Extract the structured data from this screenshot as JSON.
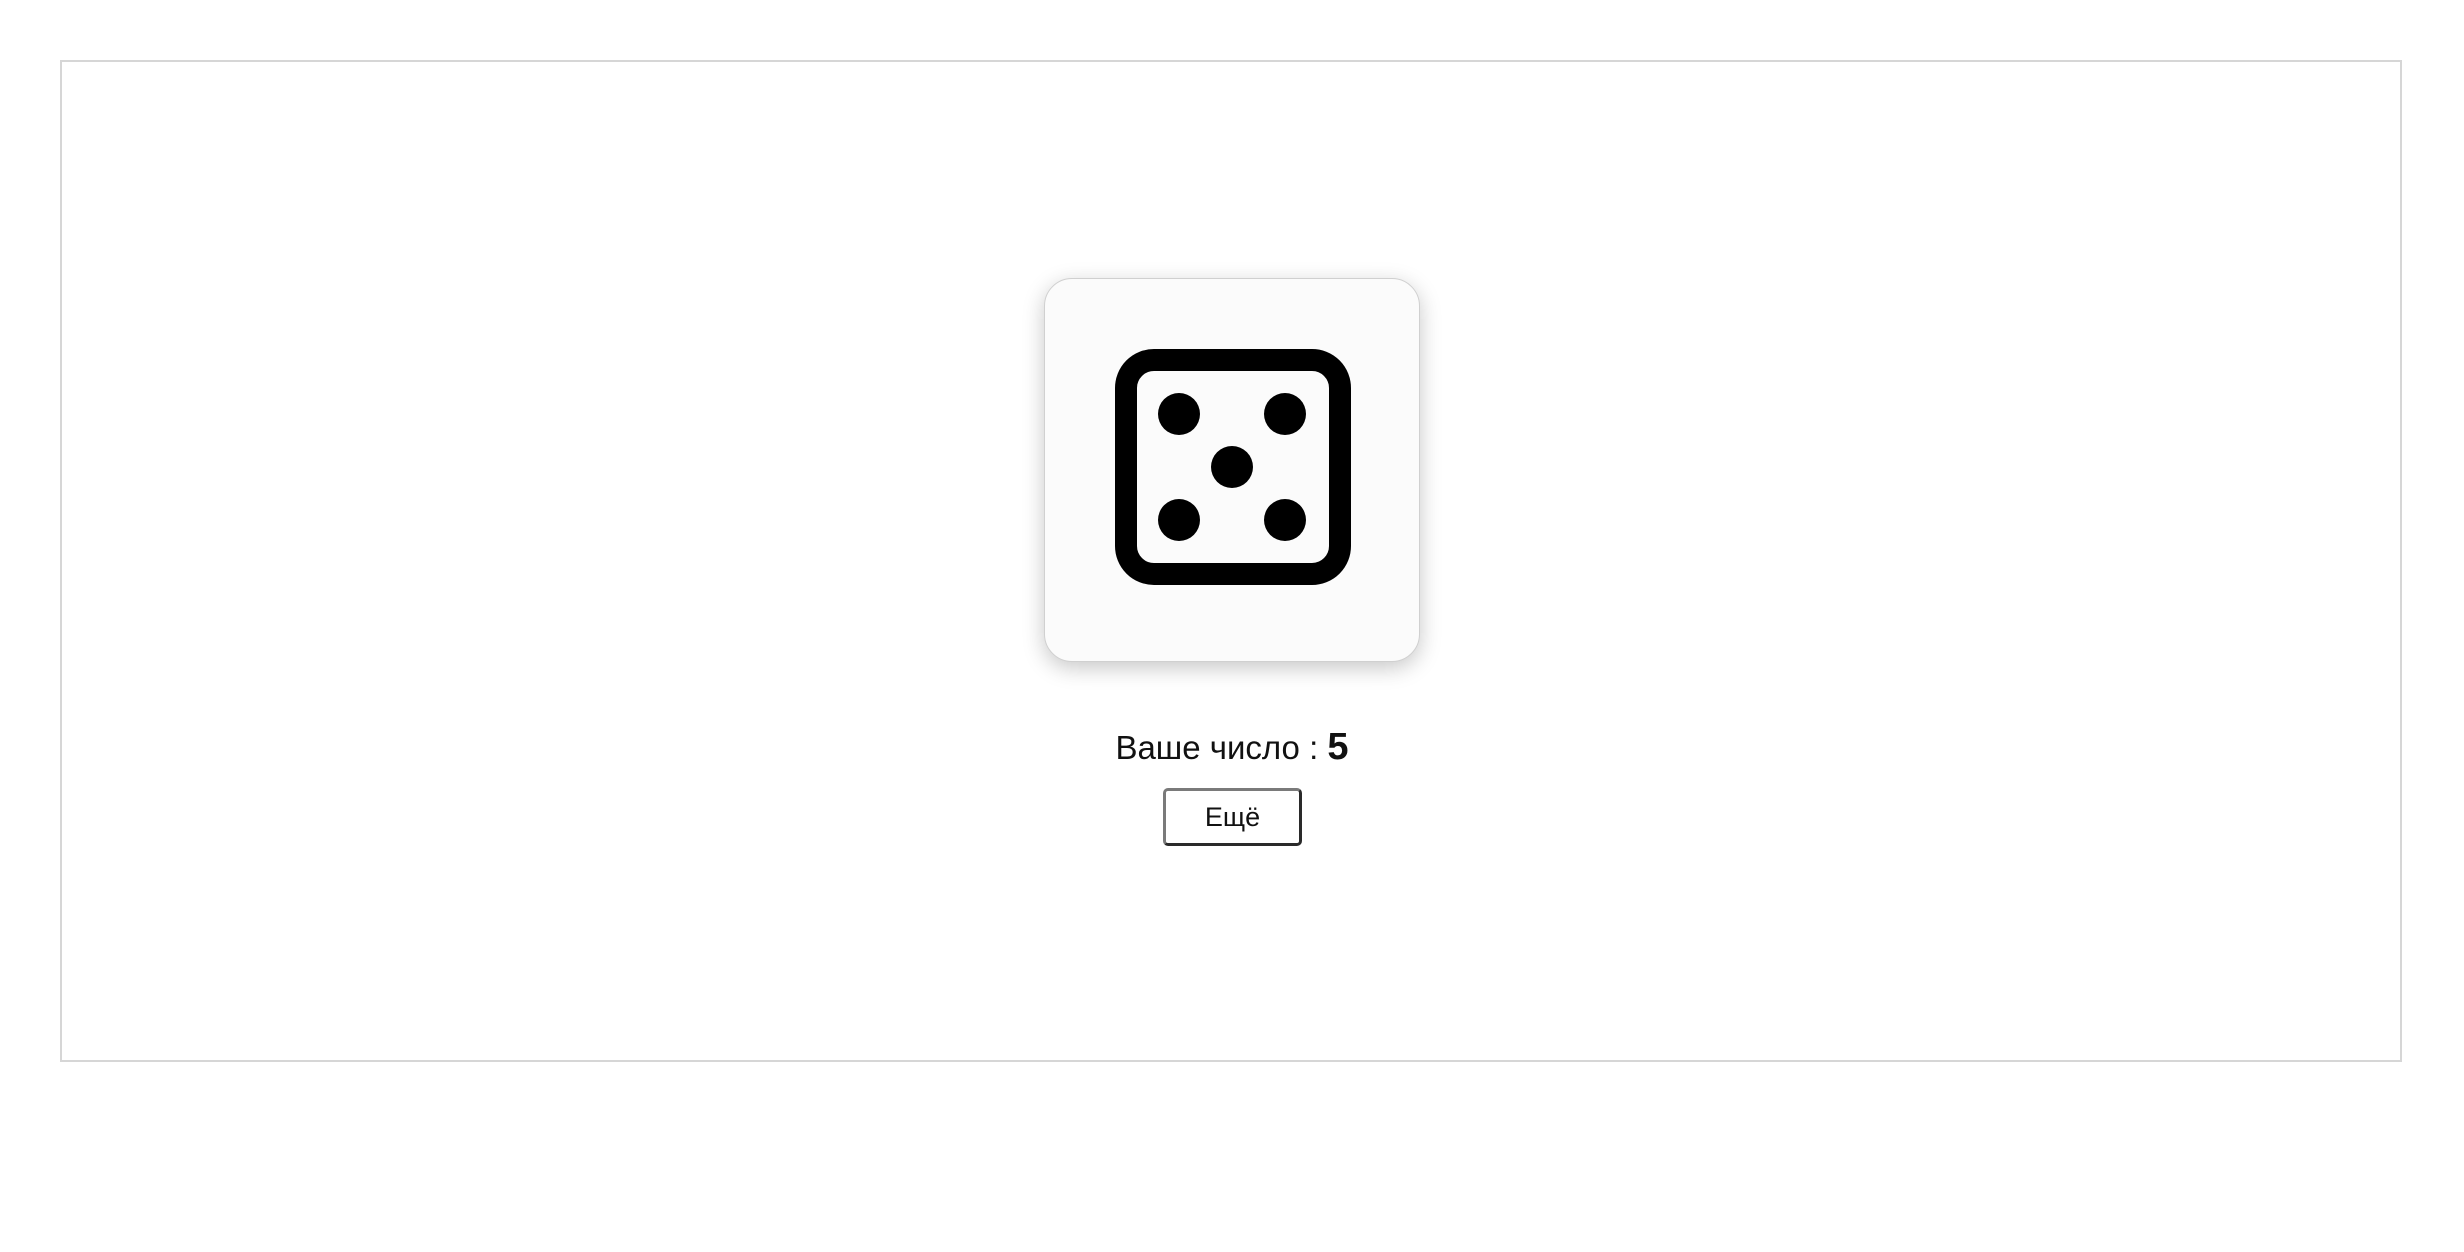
{
  "die": {
    "icon": "dice-five-icon",
    "face_value": 5
  },
  "result": {
    "label": "Ваше число :",
    "value": "5"
  },
  "actions": {
    "again_label": "Ещё"
  },
  "colors": {
    "die": "#000000",
    "frame_border": "#d6d6d6",
    "button_border": "#2a2a2a"
  }
}
